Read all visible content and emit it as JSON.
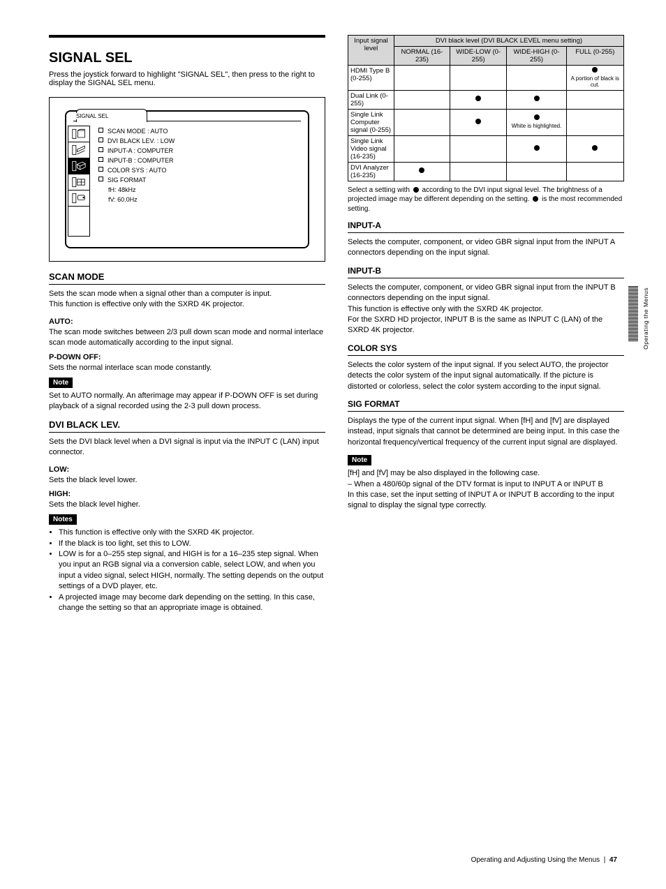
{
  "left": {
    "main_title": "SIGNAL SEL",
    "subtitle": "Press the joystick forward to highlight \"SIGNAL SEL\", then press to the right to display the SIGNAL SEL menu.",
    "screen": {
      "tab_title": "SIGNAL SEL",
      "items": [
        {
          "label": "SCAN MODE",
          "value": "AUTO"
        },
        {
          "label": "DVI BLACK LEV.",
          "value": "LOW"
        },
        {
          "label": "INPUT-A",
          "value": "COMPUTER"
        },
        {
          "label": "INPUT-B",
          "value": "COMPUTER"
        },
        {
          "label": "COLOR SYS",
          "value": "AUTO"
        },
        {
          "label": "SIG FORMAT",
          "value": ""
        },
        {
          "label": "fH: 48kHz",
          "value": ""
        },
        {
          "label": "fV: 60.0Hz",
          "value": ""
        }
      ]
    },
    "sections": [
      {
        "title": "SCAN MODE",
        "body": "Sets the scan mode when a signal other than a computer is input.\nThis function is effective only with the SXRD 4K projector.",
        "items": [
          {
            "label": "AUTO:",
            "text": "The scan mode switches between 2/3 pull down scan mode and normal interlace scan mode automatically according to the input signal."
          },
          {
            "label": "P-DOWN OFF:",
            "text": "Sets the normal interlace scan mode constantly."
          }
        ],
        "note_label": "Note",
        "note_text": "Set to AUTO normally. An afterimage may appear if P-DOWN OFF is set during playback of a signal recorded using the 2-3 pull down process."
      },
      {
        "title": "DVI BLACK LEV.",
        "body": "Sets the DVI black level when a DVI signal is input via the INPUT C (LAN) input connector.",
        "items": [
          {
            "label": "LOW:",
            "text": "Sets the black level lower."
          },
          {
            "label": "HIGH:",
            "text": "Sets the black level higher."
          }
        ],
        "note_label": "Notes",
        "note_bullets": [
          "This function is effective only with the SXRD 4K projector.",
          "If the black is too light, set this to LOW.",
          "LOW is for a 0–255 step signal, and HIGH is for a 16–235 step signal. When you input an RGB signal via a conversion cable, select LOW, and when you input a video signal, select HIGH, normally. The setting depends on the output settings of a DVD player, etc.",
          "A projected image may become dark depending on the setting. In this case, change the setting so that an appropriate image is obtained."
        ]
      }
    ]
  },
  "right": {
    "table": {
      "header_span": "DVI black level (DVI BLACK LEVEL menu setting)",
      "col0": "Input signal level",
      "cols": [
        "NORMAL (16-235)",
        "WIDE-LOW (0-255)",
        "WIDE-HIGH (0-255)",
        "FULL (0-255)"
      ],
      "rows": [
        {
          "label": "HDMI Type B (0-255)",
          "dots": [
            false,
            false,
            false,
            true
          ],
          "note": "A portion of black is cut."
        },
        {
          "label": "Dual Link (0-255)",
          "dots": [
            false,
            true,
            true,
            false
          ]
        },
        {
          "label": "Single Link Computer signal (0-255)",
          "dots": [
            false,
            true,
            true,
            false
          ],
          "note": "White is highlighted."
        },
        {
          "label": "Single Link Video signal (16-235)",
          "dots": [
            false,
            false,
            true,
            true
          ]
        },
        {
          "label": "DVI Analyzer (16-235)",
          "dots": [
            true,
            false,
            false,
            false
          ]
        }
      ],
      "footnote": "Select a setting with  according to the DVI input signal level. The brightness of a projected image may be different depending on the setting.  is the most recommended setting."
    },
    "sections": [
      {
        "title": "INPUT-A",
        "body": "Selects the computer, component, or video GBR signal input from the INPUT A connectors depending on the input signal."
      },
      {
        "title": "INPUT-B",
        "body": "Selects the computer, component, or video GBR signal input from the INPUT B connectors depending on the input signal.\nThis function is effective only with the SXRD 4K projector.\nFor the SXRD HD projector, INPUT B is the same as INPUT C (LAN) of the SXRD 4K projector."
      },
      {
        "title": "COLOR SYS",
        "body": "Selects the color system of the input signal.\nIf you select AUTO, the projector detects the color system of the input signal automatically. If the picture is distorted or colorless, select the color system according to the input signal."
      },
      {
        "title": "SIG FORMAT",
        "body": "Displays the type of the current input signal. When [fH] and [fV] are displayed instead, input signals that cannot be determined are being input. In this case the horizontal frequency/vertical frequency of the current input signal are displayed.",
        "note_label": "Note",
        "note_text": "[fH] and [fV] may be also displayed in the following case.\n– When a 480/60p signal of the DTV format is input to INPUT A or INPUT B\nIn this case, set the input setting of INPUT A or INPUT B according to the input signal to display the signal type correctly."
      }
    ]
  },
  "footer": {
    "text": "Operating and Adjusting Using the Menus",
    "page": "47"
  },
  "side_label": "Operating the Menus"
}
